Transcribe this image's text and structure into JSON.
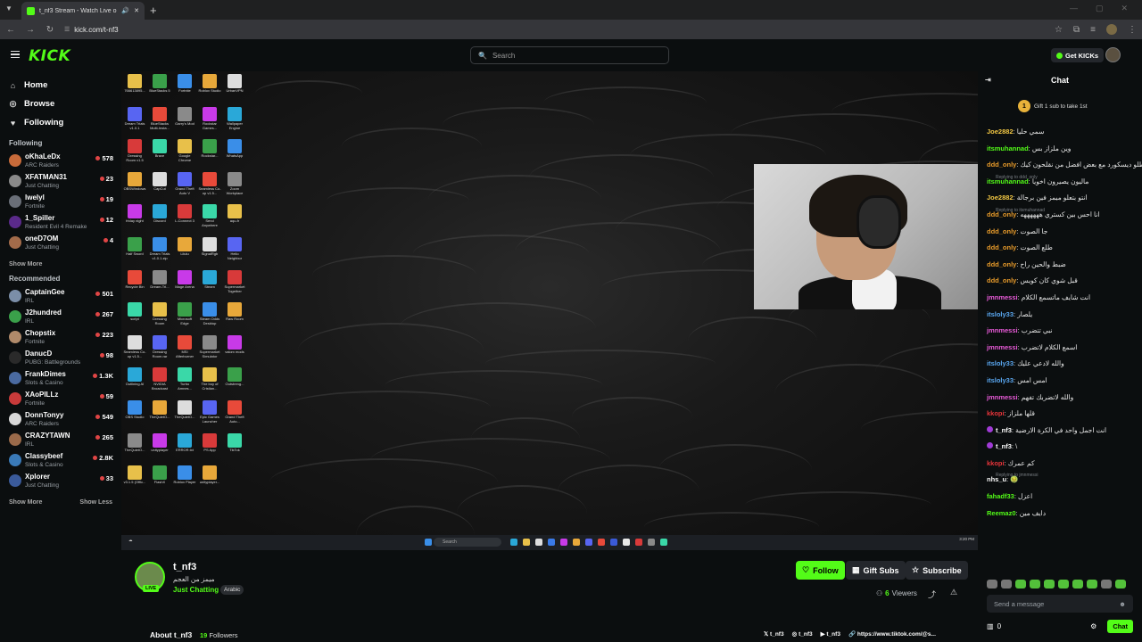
{
  "browser": {
    "tab_title": "t_nf3 Stream - Watch Live on K",
    "url": "kick.com/t-nf3"
  },
  "header": {
    "logo": "KICK",
    "search_placeholder": "Search",
    "get_kicks": "Get KICKs"
  },
  "sidebar": {
    "nav": [
      {
        "label": "Home",
        "icon": "home-icon"
      },
      {
        "label": "Browse",
        "icon": "browse-icon"
      },
      {
        "label": "Following",
        "icon": "heart-icon"
      }
    ],
    "following_title": "Following",
    "following": [
      {
        "name": "oKhaLeDx",
        "category": "ARC Raiders",
        "viewers": "578",
        "color": "#c86b3a"
      },
      {
        "name": "XFATMAN31",
        "category": "Just Chatting",
        "viewers": "23",
        "color": "#8a8a8a"
      },
      {
        "name": "lwelyl",
        "category": "Fortnite",
        "viewers": "19",
        "color": "#6a6f78"
      },
      {
        "name": "1_Spiller",
        "category": "Resident Evil 4 Remake",
        "viewers": "12",
        "color": "#5a2a8a"
      },
      {
        "name": "oneD7OM",
        "category": "Just Chatting",
        "viewers": "4",
        "color": "#a36b4a"
      }
    ],
    "show_more_1": "Show More",
    "recommended_title": "Recommended",
    "recommended": [
      {
        "name": "CaptainGee",
        "category": "IRL",
        "viewers": "501",
        "color": "#7b8ea8"
      },
      {
        "name": "J2hundred",
        "category": "IRL",
        "viewers": "267",
        "color": "#3aa04a"
      },
      {
        "name": "Chopstix",
        "category": "Fortnite",
        "viewers": "223",
        "color": "#b08a6a"
      },
      {
        "name": "DanucD",
        "category": "PUBG: Battlegrounds",
        "viewers": "98",
        "color": "#2a2a2a"
      },
      {
        "name": "FrankDimes",
        "category": "Slots & Casino",
        "viewers": "1.3K",
        "color": "#4a6aa0"
      },
      {
        "name": "XAoPILLz",
        "category": "Fortnite",
        "viewers": "59",
        "color": "#c83a3a"
      },
      {
        "name": "DonnTonyy",
        "category": "ARC Raiders",
        "viewers": "549",
        "color": "#d8d8d8"
      },
      {
        "name": "CRAZYTAWN",
        "category": "IRL",
        "viewers": "265",
        "color": "#9a6a4a"
      },
      {
        "name": "Classybeef",
        "category": "Slots & Casino",
        "viewers": "2.8K",
        "color": "#3a7ab8"
      },
      {
        "name": "Xplorer",
        "category": "Just Chatting",
        "viewers": "33",
        "color": "#3a5a9a"
      }
    ],
    "show_more_2": "Show More",
    "show_less": "Show Less"
  },
  "stream": {
    "name": "t_nf3",
    "title": "ميمز من العجم",
    "category": "Just Chatting",
    "language": "Arabic",
    "live": "LIVE",
    "follow": "Follow",
    "gift_subs": "Gift Subs",
    "subscribe": "Subscribe",
    "viewers": "6",
    "viewers_label": "Viewers",
    "about": "About t_nf3",
    "followers_count": "19",
    "followers_label": "Followers",
    "socials": [
      "t_nf3",
      "t_nf3",
      "t_nf3",
      "https://www.tiktok.com/@s..."
    ]
  },
  "desktop": {
    "taskbar_search": "Search",
    "clock": "3:20 PM",
    "icons": [
      "766613895...",
      "BlueStacks 5",
      "Fortnite",
      "Roblox Studio",
      "UrbanVPN",
      "Dream Trials v1.0.1",
      "BlueStacks Multi-Insta...",
      "Garry's Mod",
      "Rockstar Games...",
      "Wallpaper Engine",
      "Dressing Room v1.5",
      "Brave",
      "Google Chrome",
      "Rockstar...",
      "WhatsApp",
      "OBSWindows",
      "CapCut",
      "Grand Theft Auto V",
      "Seamless Co-op v1.5...",
      "Zoom Workplace",
      "friday night",
      "Discord",
      "L-Connect 3",
      "Send Anywhere",
      "aqu-fr",
      "Half Sword",
      "Dream Trials v1.0.1.zip",
      "Lilulu",
      "SignalRgb",
      "Hello Neighbor",
      "Recycle Bin",
      "Dream-Tri...",
      "Mage Arena",
      "Steam",
      "Supermarket Together",
      "script",
      "Dressing Room",
      "Microsoft Edge",
      "Steam Odds Desktop",
      "Raw Room",
      "Seamless Co-op v1.5...",
      "Dressing Room.rar",
      "MSI Afterburner",
      "Supermarket Simulator",
      "valorx mods",
      "Outlining AI",
      "NVIDIA Broadcast",
      "Turbo Amnes...",
      "The boy of Cristian...",
      "Outstreng...",
      "OBS Studio",
      "TheQuietO...",
      "TheQuietO...",
      "Epic Games Launcher",
      "Grand Theft Auto...",
      "TheQuietO...",
      "unityplayer",
      "ERROR.txt",
      "PS App",
      "TikTok",
      "v3.1.5 (Offic...",
      "FlashX",
      "Roblox Player",
      "unityplayer..."
    ]
  },
  "chat": {
    "title": "Chat",
    "pinned_count": "1",
    "pinned_text": "Gift 1 sub to take 1st",
    "messages": [
      {
        "user": "Joe2882",
        "color": "#f2c744",
        "text": "سمي حليا"
      },
      {
        "user": "itsmuhannad",
        "color": "#53fc18",
        "text": "وين ملزاز بس"
      },
      {
        "user": "ddd_only",
        "color": "#e89b2a",
        "text": "انطلو ديسكورد مع بعض افضل من نقلحون كيك"
      },
      {
        "user": "itsmuhannad",
        "color": "#53fc18",
        "text": "ماليون يصيرون اخويا",
        "reply": "Replying to ddd_only"
      },
      {
        "user": "Joe2882",
        "color": "#f2c744",
        "text": "انتو بتعلو ميمز فين برجالة"
      },
      {
        "user": "ddd_only",
        "color": "#e89b2a",
        "text": "انا احس بين كستري ههههههه",
        "reply": "Replying to itsmuhannad"
      },
      {
        "user": "ddd_only",
        "color": "#e89b2a",
        "text": "جا الصوت"
      },
      {
        "user": "ddd_only",
        "color": "#e89b2a",
        "text": "طلع الصوت"
      },
      {
        "user": "ddd_only",
        "color": "#e89b2a",
        "text": "ضبط والحين راح"
      },
      {
        "user": "ddd_only",
        "color": "#e89b2a",
        "text": "قبل شوي كان كويس"
      },
      {
        "user": "jmnmessi",
        "color": "#e85ad8",
        "text": "انت شايف ماتسمع الكلام"
      },
      {
        "user": "itsloly33",
        "color": "#5aa8f2",
        "text": "يلصار"
      },
      {
        "user": "jmnmessi",
        "color": "#e85ad8",
        "text": "نبي تتضرب"
      },
      {
        "user": "jmnmessi",
        "color": "#e85ad8",
        "text": "اسمع الكلام لاتضرب"
      },
      {
        "user": "itsloly33",
        "color": "#5aa8f2",
        "text": "والله لادعي عليك"
      },
      {
        "user": "itsloly33",
        "color": "#5aa8f2",
        "text": "امس امس"
      },
      {
        "user": "jmnmessi",
        "color": "#e85ad8",
        "text": "والله لاتضربك تفهم"
      },
      {
        "user": "kkopi",
        "color": "#e8343a",
        "text": "قلها ملزاز"
      },
      {
        "user": "t_nf3",
        "color": "#ffffff",
        "text": "انت اجمل واحد في الكرة الارضية",
        "badge": true
      },
      {
        "user": "t_nf3",
        "color": "#ffffff",
        "text": "\\",
        "badge": true
      },
      {
        "user": "kkopi",
        "color": "#e8343a",
        "text": "كم عمرك"
      },
      {
        "user": "nhs_u",
        "color": "#ffffff",
        "text": "🤢",
        "reply": "Replying to jmnmessi"
      },
      {
        "user": "fahadf33",
        "color": "#53fc18",
        "text": "اعزل"
      },
      {
        "user": "Reemaz0",
        "color": "#53fc18",
        "text": "دايف مين"
      }
    ],
    "send_placeholder": "Send a message",
    "points": "0",
    "chat_button": "Chat"
  },
  "colors": {
    "accent": "#53fc18",
    "bg": "#0b0e0f",
    "panel": "#24272c"
  }
}
